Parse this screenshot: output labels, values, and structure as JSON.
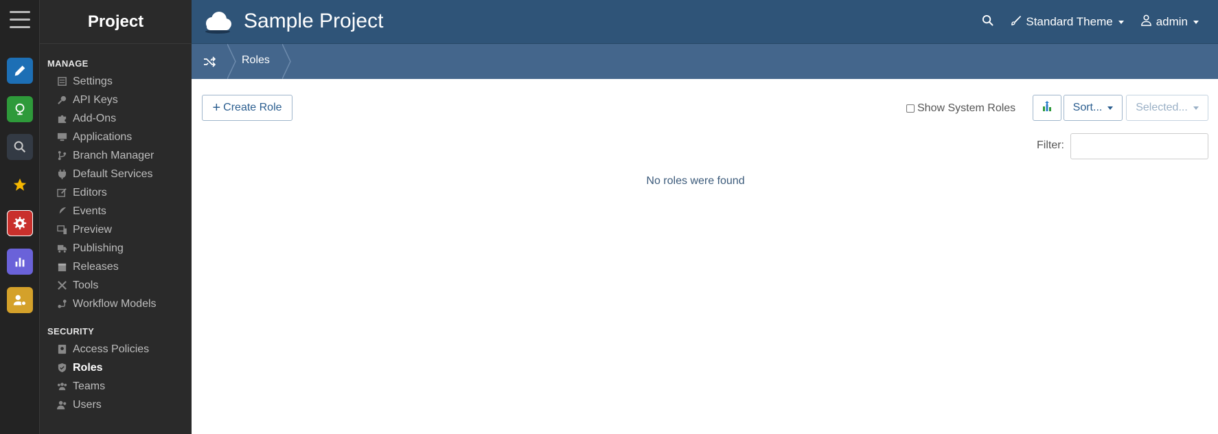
{
  "sidebar": {
    "title": "Project",
    "sections": [
      {
        "label": "MANAGE",
        "items": [
          {
            "label": "Settings",
            "icon": "settings-icon"
          },
          {
            "label": "API Keys",
            "icon": "key-icon"
          },
          {
            "label": "Add-Ons",
            "icon": "puzzle-icon"
          },
          {
            "label": "Applications",
            "icon": "monitor-icon"
          },
          {
            "label": "Branch Manager",
            "icon": "branch-icon"
          },
          {
            "label": "Default Services",
            "icon": "plug-icon"
          },
          {
            "label": "Editors",
            "icon": "edit-icon"
          },
          {
            "label": "Events",
            "icon": "feather-icon"
          },
          {
            "label": "Preview",
            "icon": "preview-icon"
          },
          {
            "label": "Publishing",
            "icon": "truck-icon"
          },
          {
            "label": "Releases",
            "icon": "calendar-icon"
          },
          {
            "label": "Tools",
            "icon": "tools-icon"
          },
          {
            "label": "Workflow Models",
            "icon": "workflow-icon"
          }
        ]
      },
      {
        "label": "SECURITY",
        "items": [
          {
            "label": "Access Policies",
            "icon": "policy-icon"
          },
          {
            "label": "Roles",
            "icon": "shield-check-icon",
            "active": true
          },
          {
            "label": "Teams",
            "icon": "team-icon"
          },
          {
            "label": "Users",
            "icon": "users-icon"
          }
        ]
      }
    ]
  },
  "rail": [
    {
      "icon": "pencil-icon",
      "color": "#1d6fb5"
    },
    {
      "icon": "globe-icon",
      "color": "#2e9a3a"
    },
    {
      "icon": "search-icon",
      "color": "#333a44"
    },
    {
      "icon": "star-icon",
      "color": "#232323"
    },
    {
      "icon": "gear-icon",
      "color": "#c9302c"
    },
    {
      "icon": "bar-chart-icon",
      "color": "#6a62d9"
    },
    {
      "icon": "user-gear-icon",
      "color": "#d4a12a"
    }
  ],
  "header": {
    "project_title": "Sample Project",
    "theme_label": "Standard Theme",
    "user_label": "admin"
  },
  "breadcrumb": {
    "current": "Roles"
  },
  "toolbar": {
    "create_label": "Create Role",
    "show_system_label": "Show System Roles",
    "sort_label": "Sort...",
    "selected_label": "Selected..."
  },
  "filter": {
    "label": "Filter:",
    "value": ""
  },
  "empty_message": "No roles were found",
  "colors": {
    "topbar": "#2f5478",
    "breadcrumb_bar": "#44668c",
    "sidebar": "#2a2a2a",
    "accent_text": "#2a5d8f"
  }
}
